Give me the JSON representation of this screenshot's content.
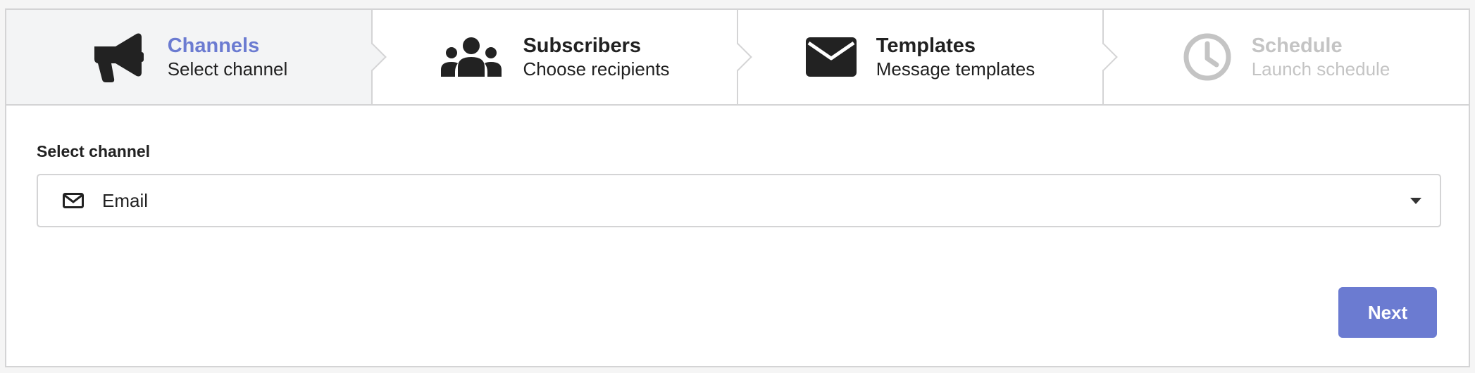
{
  "steps": [
    {
      "title": "Channels",
      "description": "Select channel",
      "icon": "megaphone-icon",
      "state": "active"
    },
    {
      "title": "Subscribers",
      "description": "Choose recipients",
      "icon": "users-icon",
      "state": "default"
    },
    {
      "title": "Templates",
      "description": "Message templates",
      "icon": "envelope-icon",
      "state": "default"
    },
    {
      "title": "Schedule",
      "description": "Launch schedule",
      "icon": "clock-icon",
      "state": "disabled"
    }
  ],
  "form": {
    "label": "Select channel",
    "selected_value": "Email",
    "selected_icon": "envelope-outline-icon"
  },
  "actions": {
    "next_label": "Next"
  },
  "colors": {
    "accent": "#6b7bd1",
    "active_step_bg": "#f3f4f5",
    "disabled_text": "#c4c4c4",
    "border": "#d4d4d5"
  }
}
